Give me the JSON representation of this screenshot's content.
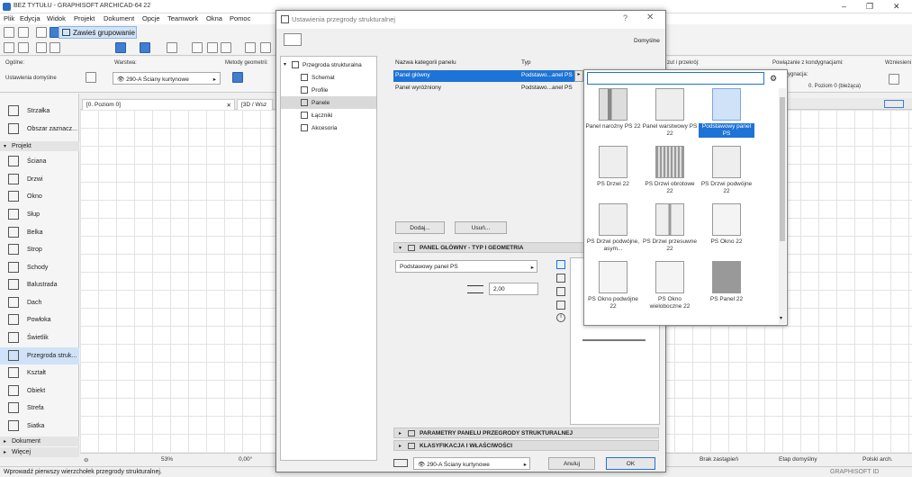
{
  "app": {
    "title": "BEZ TYTUŁU - GRAPHISOFT ARCHICAD-64 22",
    "menu": [
      "Plik",
      "Edycja",
      "Widok",
      "Projekt",
      "Dokument",
      "Opcje",
      "Teamwork",
      "Okna",
      "Pomoc"
    ]
  },
  "toolbar": {
    "group_label": "Zawieś grupowanie"
  },
  "info_box": {
    "general_label": "Ogólne:",
    "default_settings": "Ustawienia domyślne",
    "layer_label": "Warstwa:",
    "layer_value": "290-A Ściany kurtynowe",
    "geometry_label": "Metody geometrii:",
    "floor_label": "Powiązanie z kondygnacjami:",
    "floor_sub": "ygnacja:",
    "floor_value": "0. Poziom 0 (bieżąca)",
    "height_label": "Wzniesieni",
    "cut_label": "zut i przekrój:"
  },
  "left_panel": {
    "items_top": [
      "Strzałka",
      "Obszar zaznacz..."
    ],
    "section_project": "Projekt",
    "items": [
      "Ściana",
      "Drzwi",
      "Okno",
      "Słup",
      "Belka",
      "Strop",
      "Schody",
      "Balustrada",
      "Dach",
      "Powłoka",
      "Świetlik",
      "Przegroda struk...",
      "Kształt",
      "Obiekt",
      "Strefa",
      "Siatka"
    ],
    "section_doc": "Dokument",
    "section_more": "Więcej"
  },
  "tabs": [
    "[0. Poziom 0]",
    "[3D / Wsz"
  ],
  "bottom_bar": {
    "zoom": "53%",
    "angle": "0,00°",
    "replace": "Brak zastąpień",
    "stage": "Etap domyślny",
    "lang": "Polski arch."
  },
  "status": {
    "text": "Wprowadź pierwszy wierzchołek przegrody strukturalnej.",
    "brand": "GRAPHISOFT ID"
  },
  "dialog": {
    "title": "Ustawienia przegrody strukturalnej",
    "default": "Domyślne",
    "tree": [
      "Przegroda strukturalna",
      "Schemat",
      "Profile",
      "Panele",
      "Łączniki",
      "Akcesoria"
    ],
    "list_head": {
      "name": "Nazwa kategorii panelu",
      "type": "Typ"
    },
    "list_rows": [
      {
        "name": "Panel główny",
        "type": "Podstawo...anel PS"
      },
      {
        "name": "Panel wyróżniony",
        "type": "Podstawo...anel PS"
      }
    ],
    "add_btn": "Dodaj...",
    "remove_btn": "Usuń...",
    "section_main": "PANEL GŁÓWNY - TYP I GEOMETRIA",
    "panel_select": "Podstawowy panel PS",
    "thickness": "2,00",
    "section_params": "PARAMETRY PANELU PRZEGRODY STRUKTURALNEJ",
    "section_class": "KLASYFIKACJA I WŁAŚCIWOŚCI",
    "footer_layer": "290-A Ściany kurtynowe",
    "cancel": "Anuluj",
    "ok": "OK"
  },
  "picker": {
    "search_value": "",
    "items": [
      "Panel narożny PS 22",
      "Panel warstwowy PS 22",
      "Podstawowy panel PS",
      "PS Drzwi 22",
      "PS Drzwi obrotowe 22",
      "PS Drzwi podwójne 22",
      "PS Drzwi podwójne, asym...",
      "PS Drzwi przesuwne 22",
      "PS Okno 22",
      "PS Okno podwójne 22",
      "PS Okno wieloboczne 22",
      "PS Panel 22"
    ],
    "selected_index": 2
  },
  "colors": {
    "selection": "#1e73d6",
    "accent_blue": "#3f7ed1"
  }
}
